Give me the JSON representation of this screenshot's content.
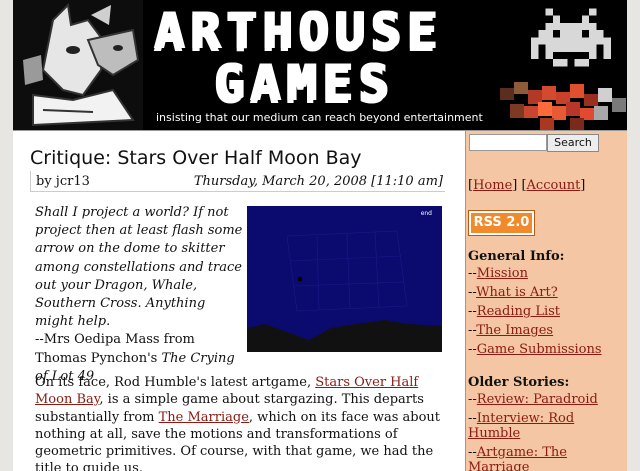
{
  "banner": {
    "title_line1": "ARTHOUSE",
    "title_line2": "GAMES",
    "tagline": "insisting that our medium can reach beyond entertainment"
  },
  "post": {
    "title": "Critique: Stars Over Half Moon Bay",
    "byline": "by jcr13",
    "date": "Thursday, March 20, 2008 [11:10 am]",
    "quote_text": "Shall I project a world? If not project then at least flash some arrow on the dome to skitter among constellations and trace out your Dragon, Whale, Southern Cross. Anything might help.",
    "quote_attribution_prefix": "--Mrs Oedipa Mass from Thomas Pynchon's ",
    "quote_book_title": "The Crying of Lot 49",
    "game_screenshot_text": "end",
    "body_part1": "On its face, Rod Humble's latest artgame, ",
    "body_link1": "Stars Over Half Moon Bay",
    "body_part2": ", is a simple game about stargazing. This departs substantially from ",
    "body_link2": "The Marriage",
    "body_part3": ", which on its face was about nothing at all, save the motions and transformations of geometric primitives. Of course, with that game, we had the title to guide us."
  },
  "sidebar": {
    "search_placeholder": "",
    "search_button": "Search",
    "link_home": "Home",
    "link_account": "Account",
    "rss_label": "RSS 2.0",
    "general_info_heading": "General Info:",
    "general_info_items": [
      "Mission",
      "What is Art?",
      "Reading List",
      "The Images",
      "Game Submissions"
    ],
    "older_stories_heading": "Older Stories:",
    "older_stories_items": [
      "Review: Paradroid",
      "Interview: Rod Humble",
      "Artgame: The Marriage"
    ]
  },
  "colors": {
    "link": "#8b1a12",
    "sidebar_bg": "#f4c6a4",
    "rss_orange": "#f08a2c",
    "game_bg": "#0b0a6e"
  }
}
